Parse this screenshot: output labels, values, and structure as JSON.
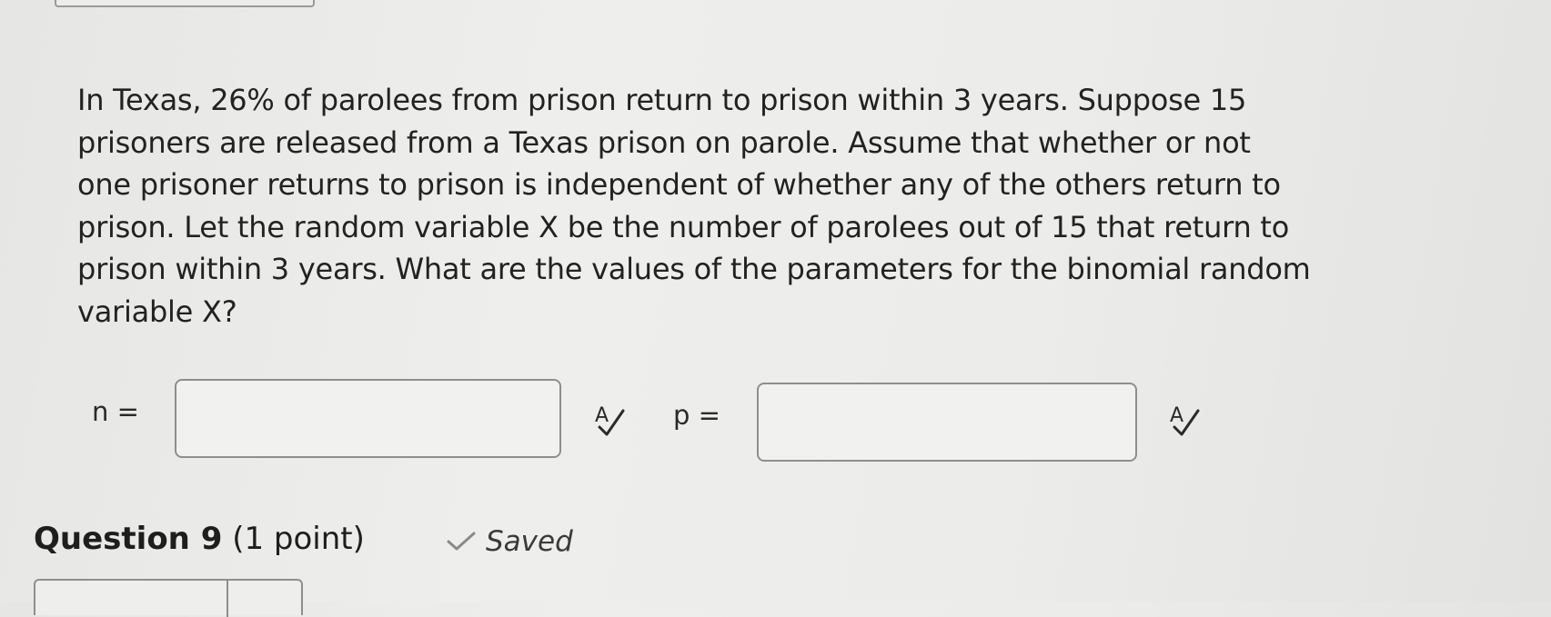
{
  "question": {
    "lines": [
      "In Texas, 26% of parolees from prison return to prison within 3 years. Suppose 15",
      "prisoners are released from a Texas prison on parole. Assume that whether or not",
      "one prisoner returns to prison is independent of whether any of the others return to",
      "prison. Let the random variable X be the number of parolees out of 15 that return to",
      "prison within 3 years. What are the values of the parameters for the binomial random",
      "variable X?"
    ]
  },
  "fields": {
    "n": {
      "label": "n =",
      "value": ""
    },
    "p": {
      "label": "p =",
      "value": ""
    }
  },
  "icons": {
    "spell_check": "spell-check-icon",
    "saved": "checkmark-icon"
  },
  "footer": {
    "question_number": "Question 9",
    "points": "(1 point)",
    "status": "Saved"
  }
}
